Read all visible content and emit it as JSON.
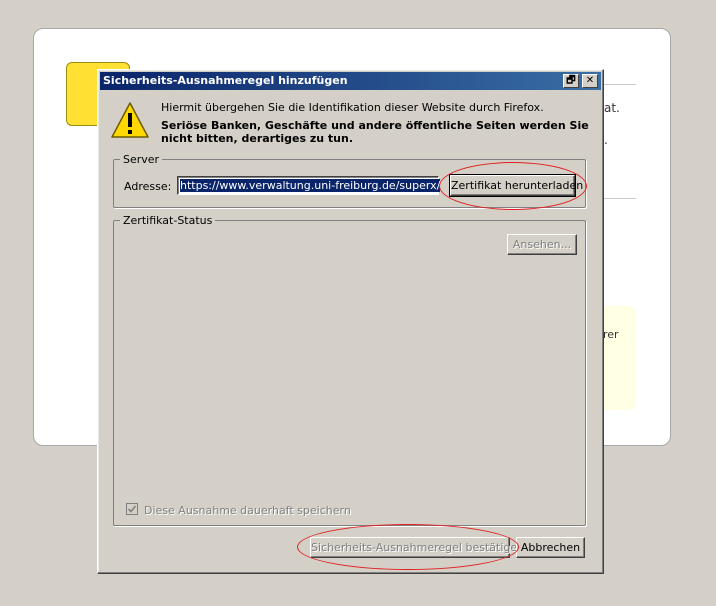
{
  "background": {
    "fragments": [
      "at.",
      ".",
      "rer"
    ]
  },
  "dialog": {
    "title": "Sicherheits-Ausnahmeregel hinzufügen",
    "controls": {
      "restore": "🗗",
      "close": "✕"
    },
    "message_line1": "Hiermit übergehen Sie die Identifikation dieser Website durch Firefox.",
    "message_line2": "Seriöse Banken, Geschäfte und andere öffentliche Seiten werden Sie nicht bitten, derartiges zu tun.",
    "server": {
      "legend": "Server",
      "address_label": "Adresse:",
      "address_value": "https://www.verwaltung.uni-freiburg.de/superx/",
      "download_button": "Zertifikat herunterladen"
    },
    "cert_status": {
      "legend": "Zertifikat-Status",
      "view_button": "Ansehen...",
      "permanent_checkbox_label": "Diese Ausnahme dauerhaft speichern",
      "permanent_checked": true
    },
    "confirm_button": "Sicherheits-Ausnahmeregel bestätigen",
    "cancel_button": "Abbrechen"
  },
  "colors": {
    "titlebar_start": "#0a246a",
    "titlebar_end": "#3a6ea5",
    "annotation_circle": "#e02020",
    "selection": "#0a246a"
  }
}
